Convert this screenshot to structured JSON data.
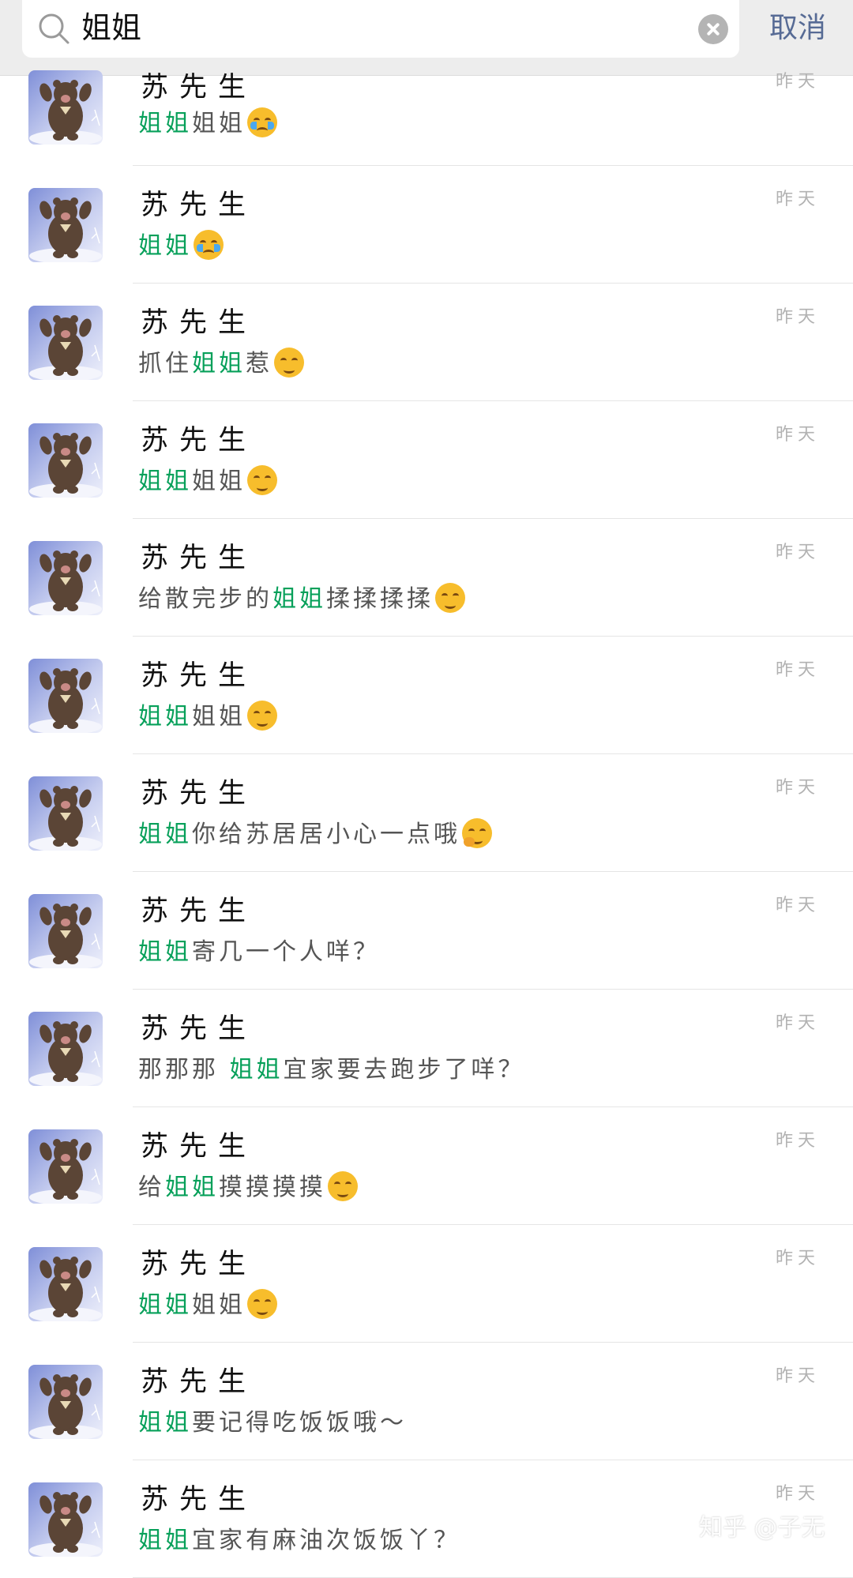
{
  "search": {
    "query": "姐姐",
    "cancel_label": "取消"
  },
  "results": [
    {
      "name": "苏先生",
      "time": "昨天",
      "pre": "",
      "highlight": "姐姐",
      "post": "姐姐",
      "emoji": "loudly-crying-face"
    },
    {
      "name": "苏先生",
      "time": "昨天",
      "pre": "",
      "highlight": "姐姐",
      "post": "",
      "emoji": "loudly-crying-face"
    },
    {
      "name": "苏先生",
      "time": "昨天",
      "pre": "抓住",
      "highlight": "姐姐",
      "post": "惹",
      "emoji": "smiling-face"
    },
    {
      "name": "苏先生",
      "time": "昨天",
      "pre": "",
      "highlight": "姐姐",
      "post": "姐姐",
      "emoji": "smiling-face"
    },
    {
      "name": "苏先生",
      "time": "昨天",
      "pre": "给散完步的",
      "highlight": "姐姐",
      "post": "揉揉揉揉",
      "emoji": "smiling-face"
    },
    {
      "name": "苏先生",
      "time": "昨天",
      "pre": "",
      "highlight": "姐姐",
      "post": "姐姐",
      "emoji": "smiling-face"
    },
    {
      "name": "苏先生",
      "time": "昨天",
      "pre": "",
      "highlight": "姐姐",
      "post": "你给苏居居小心一点哦",
      "emoji": "thinking-face"
    },
    {
      "name": "苏先生",
      "time": "昨天",
      "pre": "",
      "highlight": "姐姐",
      "post": "寄几一个人咩？",
      "emoji": ""
    },
    {
      "name": "苏先生",
      "time": "昨天",
      "pre": "那那那 ",
      "highlight": "姐姐",
      "post": "宜家要去跑步了咩？",
      "emoji": ""
    },
    {
      "name": "苏先生",
      "time": "昨天",
      "pre": "给",
      "highlight": "姐姐",
      "post": "摸摸摸摸",
      "emoji": "smiling-face"
    },
    {
      "name": "苏先生",
      "time": "昨天",
      "pre": "",
      "highlight": "姐姐",
      "post": "姐姐",
      "emoji": "smiling-face"
    },
    {
      "name": "苏先生",
      "time": "昨天",
      "pre": "",
      "highlight": "姐姐",
      "post": "要记得吃饭饭哦～",
      "emoji": ""
    },
    {
      "name": "苏先生",
      "time": "昨天",
      "pre": "",
      "highlight": "姐姐",
      "post": "宜家有麻油次饭饭丫？",
      "emoji": ""
    }
  ],
  "watermark": "知乎 @子无",
  "colors": {
    "highlight": "#07a05a",
    "cancel": "#576b95",
    "time": "#b2b2b2"
  }
}
